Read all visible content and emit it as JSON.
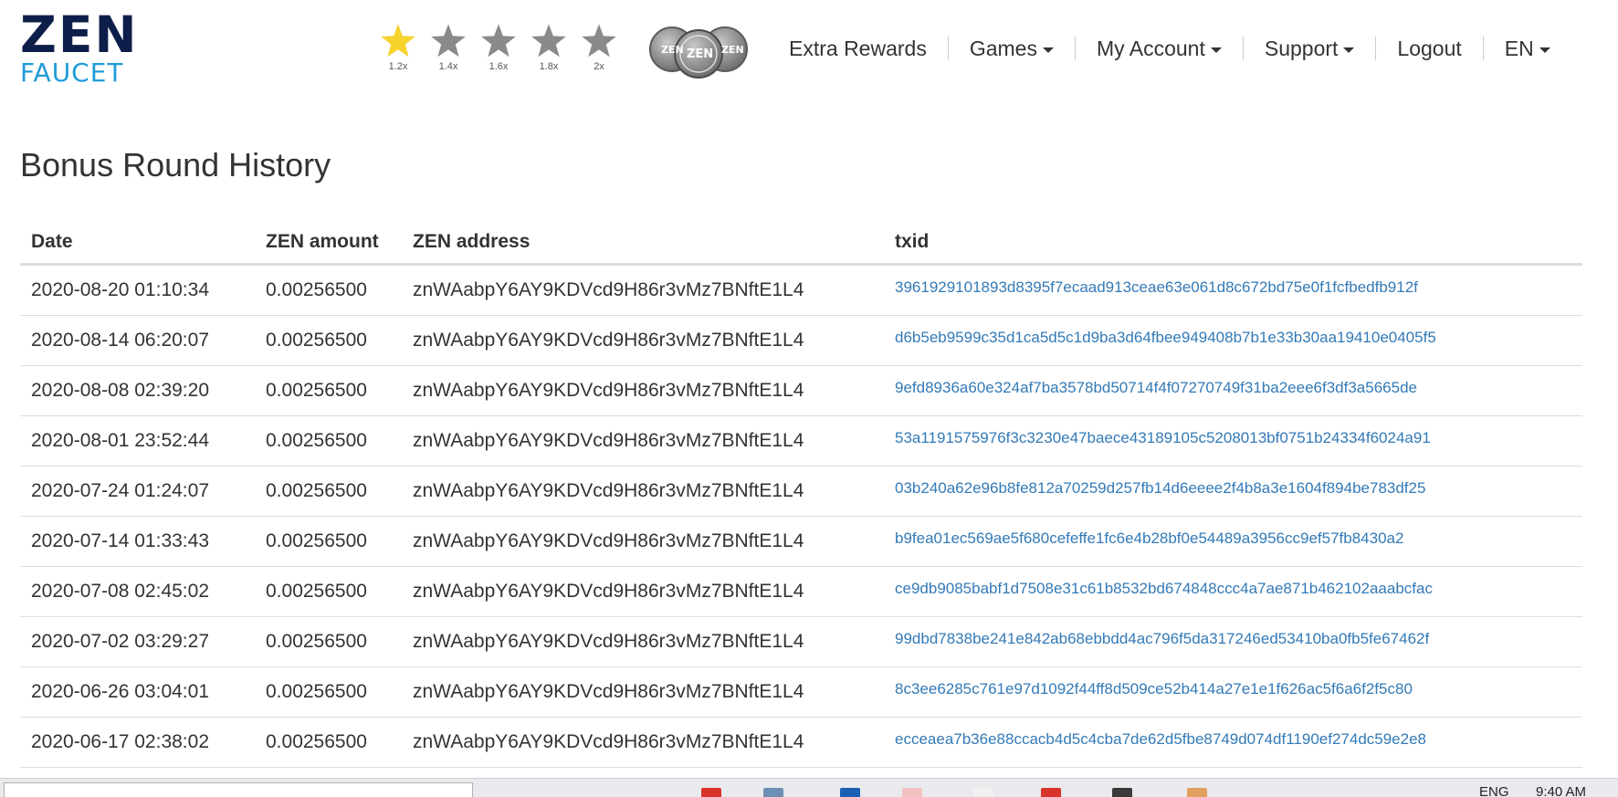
{
  "logo": {
    "line1": "ZEN",
    "line2": "FAUCET"
  },
  "multipliers": [
    {
      "label": "1.2x",
      "active": true
    },
    {
      "label": "1.4x",
      "active": false
    },
    {
      "label": "1.6x",
      "active": false
    },
    {
      "label": "1.8x",
      "active": false
    },
    {
      "label": "2x",
      "active": false
    }
  ],
  "colors": {
    "star_active": "#f6d32d",
    "star_inactive": "#8a8a8a",
    "link": "#337ab7",
    "logo_dark": "#0e1e4a",
    "logo_blue": "#1f9bd8"
  },
  "coins": {
    "left": "ZEN",
    "center": "ZEN",
    "right": "ZEN"
  },
  "nav": {
    "extra_rewards": "Extra Rewards",
    "games": "Games",
    "my_account": "My Account",
    "support": "Support",
    "logout": "Logout",
    "language": "EN"
  },
  "page_title": "Bonus Round History",
  "table": {
    "headers": {
      "date": "Date",
      "amount": "ZEN amount",
      "address": "ZEN address",
      "txid": "txid"
    },
    "rows": [
      {
        "date": "2020-08-20 01:10:34",
        "amount": "0.00256500",
        "address": "znWAabpY6AY9KDVcd9H86r3vMz7BNftE1L4",
        "txid": "3961929101893d8395f7ecaad913ceae63e061d8c672bd75e0f1fcfbedfb912f"
      },
      {
        "date": "2020-08-14 06:20:07",
        "amount": "0.00256500",
        "address": "znWAabpY6AY9KDVcd9H86r3vMz7BNftE1L4",
        "txid": "d6b5eb9599c35d1ca5d5c1d9ba3d64fbee949408b7b1e33b30aa19410e0405f5"
      },
      {
        "date": "2020-08-08 02:39:20",
        "amount": "0.00256500",
        "address": "znWAabpY6AY9KDVcd9H86r3vMz7BNftE1L4",
        "txid": "9efd8936a60e324af7ba3578bd50714f4f07270749f31ba2eee6f3df3a5665de"
      },
      {
        "date": "2020-08-01 23:52:44",
        "amount": "0.00256500",
        "address": "znWAabpY6AY9KDVcd9H86r3vMz7BNftE1L4",
        "txid": "53a1191575976f3c3230e47baece43189105c5208013bf0751b24334f6024a91"
      },
      {
        "date": "2020-07-24 01:24:07",
        "amount": "0.00256500",
        "address": "znWAabpY6AY9KDVcd9H86r3vMz7BNftE1L4",
        "txid": "03b240a62e96b8fe812a70259d257fb14d6eeee2f4b8a3e1604f894be783df25"
      },
      {
        "date": "2020-07-14 01:33:43",
        "amount": "0.00256500",
        "address": "znWAabpY6AY9KDVcd9H86r3vMz7BNftE1L4",
        "txid": "b9fea01ec569ae5f680cefeffe1fc6e4b28bf0e54489a3956cc9ef57fb8430a2"
      },
      {
        "date": "2020-07-08 02:45:02",
        "amount": "0.00256500",
        "address": "znWAabpY6AY9KDVcd9H86r3vMz7BNftE1L4",
        "txid": "ce9db9085babf1d7508e31c61b8532bd674848ccc4a7ae871b462102aaabcfac"
      },
      {
        "date": "2020-07-02 03:29:27",
        "amount": "0.00256500",
        "address": "znWAabpY6AY9KDVcd9H86r3vMz7BNftE1L4",
        "txid": "99dbd7838be241e842ab68ebbdd4ac796f5da317246ed53410ba0fb5fe67462f"
      },
      {
        "date": "2020-06-26 03:04:01",
        "amount": "0.00256500",
        "address": "znWAabpY6AY9KDVcd9H86r3vMz7BNftE1L4",
        "txid": "8c3ee6285c761e97d1092f44ff8d509ce52b414a27e1e1f626ac5f6a6f2f5c80"
      },
      {
        "date": "2020-06-17 02:38:02",
        "amount": "0.00256500",
        "address": "znWAabpY6AY9KDVcd9H86r3vMz7BNftE1L4",
        "txid": "ecceaea7b36e88ccacb4d5c4cba7de62d5fbe8749d074df1190ef274dc59e2e8"
      }
    ]
  },
  "taskbar": {
    "tray_lang": "ENG",
    "tray_time": "9:40 AM"
  }
}
